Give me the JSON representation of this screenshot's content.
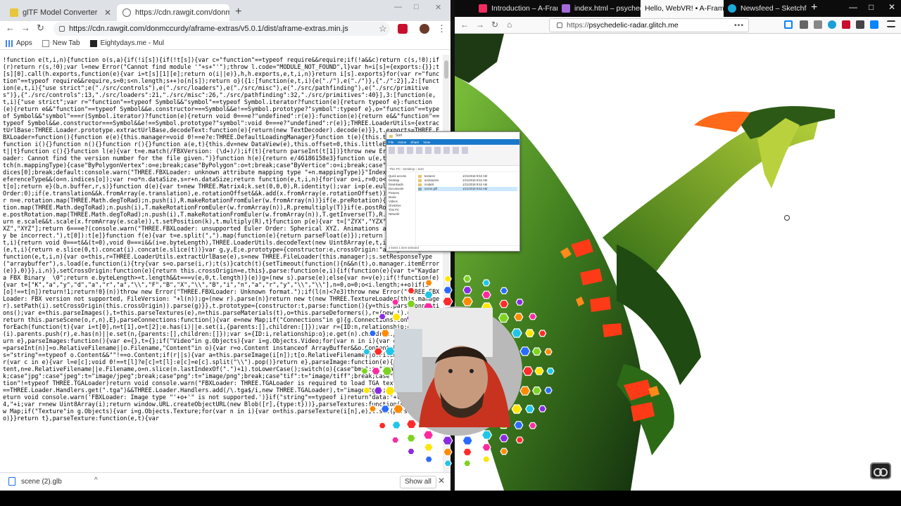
{
  "chrome": {
    "tabs": [
      {
        "title": "glTF Model Converter",
        "close": "✕"
      },
      {
        "title": "https://cdn.rawgit.com/donmccurdy",
        "close": "✕"
      }
    ],
    "new_tab": "+",
    "window_controls": [
      "—",
      "□",
      "✕"
    ],
    "nav": {
      "back": "←",
      "forward": "→",
      "reload": "↻"
    },
    "url": "https://cdn.rawgit.com/donmccurdy/aframe-extras/v5.0.1/dist/aframe-extras.min.js",
    "menu": "⋮",
    "bookmarks": [
      {
        "label": "Apps",
        "icon": "apps-grid-icon"
      },
      {
        "label": "New Tab",
        "icon": "page-icon"
      },
      {
        "label": "Eightydays.me - Mul",
        "icon": "eightydays-icon"
      }
    ],
    "code_text": "!function e(t,i,n){function o(s,a){if(!i[s]){if(!t[s]){var c=\"function\"==typeof require&&require;if(!a&&c)return c(s,!0);if(r)return r(s,!0);var l=new Error(\"Cannot find module '\"+s+\"'\");throw l.code=\"MODULE_NOT_FOUND\",l}var h=i[s]={exports:{}};t[s][0].call(h.exports,function(e){var i=t[s][1][e];return o(i||e)},h,h.exports,e,t,i,n)}return i[s].exports}for(var r=\"function\"==typeof require&&require,s=0;s<n.length;s++)o(n[s]);return o}({1:[function(e,t,i){e(\"./\"),e(\"./\")},{\"./\":2}],2:[function(e,t,i){\"use strict\";e(\"./src/controls\"),e(\"./src/loaders\"),e(\"./src/misc\"),e(\"./src/pathfinding\"),e(\"./src/primitives\")},{\"./src/controls\":13,\"./src/loaders\":21,\"./src/misc\":26,\"./src/pathfinding\":32,\"./src/primitives\":40}],3:[function(e,t,i){\"use strict\";var r=\"function\"==typeof Symbol&&\"symbol\"==typeof Symbol.iterator?function(e){return typeof e}:function(e){return e&&\"function\"==typeof Symbol&&e.constructor===Symbol&&e!==Symbol.prototype?\"symbol\":typeof e},o=\"function\"==typeof Symbol&&\"symbol\"===r(Symbol.iterator)?function(e){return void 0===e?\"undefined\":r(e)}:function(e){return e&&\"function\"==typeof Symbol&&e.constructor===Symbol&&e!==Symbol.prototype?\"symbol\":void 0===e?\"undefined\":r(e)};THREE.LoaderUtils={extractUrlBase:THREE.Loader.prototype.extractUrlBase,decodeText:function(e){return(new TextDecoder).decode(e)}},t.exports=THREE.FBXLoader=function(){function e(e){this.manager=void 0!==e?e:THREE.DefaultLoadingManager}function t(e){this.textureLoader=e}function i(){}function n(){}function r(){}function a(e,t){this.dv=new DataView(e),this.offset=0,this.littleEndian=void 0===t||t}function c(){}function l(e){var t=e.match(/FBXVersion: (\\d+)/);if(t){return parseInt(t[1])}throw new Error(\"THREE.FBXLoader: Cannot find the version number for the file given.\")}function h(e){return e/46186158e3}function u(e,t,i,n){var o;switch(n.mappingType){case\"ByPolygonVertex\":o=e;break;case\"ByPolygon\":o=t;break;case\"ByVertice\":o=i;break;case\"AllSame\":o=n.indices[0];break;default:console.warn(\"THREE.FBXLoader: unknown attribute mapping type \"+n.mappingType)}\"IndexToDirect\"===n.referenceType&&(o=n.indices[o]);var r=o*n.dataSize,s=r+n.dataSize;return function(e,t,i,n){for(var o=i,r=0;o<n;o++,r++)e[r]=t[o];return e}(b,n.buffer,r,s)}function d(e){var t=new THREE.Matrix4;k.set(0,0,0),R.identity();var i=p(e.eulerOrder?e.eulerOrder:0);if(e.translation&&k.fromArray(e.translation),e.rotationOffset&&k.add(x.fromArray(e.rotationOffset)),e.rotation){var n=e.rotation.map(THREE.Math.degToRad);n.push(i),R.makeRotationFromEuler(w.fromArray(n))}if(e.preRotation){var n=e.preRotation.map(THREE.Math.degToRad);n.push(i),T.makeRotationFromEuler(w.fromArray(n)),R.premultiply(T)}if(e.postRotation){var n=e.postRotation.map(THREE.Math.degToRad);n.push(i),T.makeRotationFromEuler(w.fromArray(n)),T.getInverse(T),R.multiply(T)}return e.scale&&t.scale(x.fromArray(e.scale)),t.setPosition(k),t.multiply(R),t}function p(e){var t=[\"ZYX\",\"YZX\",\"XZY\",\"ZXY\",\"YXZ\",\"XYZ\"];return 6===e?(console.warn(\"THREE.FBXLoader: unsupported Euler Order: Spherical XYZ. Animations and rotations may be incorrect.\"),t[0]):t[e]}function f(e){var t=e.split(\",\").map(function(e){return parseFloat(e)});return t}function v(e,t,i){return void 0===t&&(t=0),void 0===i&&(i=e.byteLength),THREE.LoaderUtils.decodeText(new Uint8Array(e,t,i))}function m(e,t,i){return e.slice(0,t).concat(i).concat(e.slice(t))}var g,y,E;e.prototype={constructor:e,crossOrigin:\"anonymous\",load:function(e,t,i,n){var o=this,r=THREE.LoaderUtils.extractUrlBase(e),s=new THREE.FileLoader(this.manager);s.setResponseType(\"arraybuffer\"),s.load(e,function(i){try{var s=o.parse(i,r);t(s)}catch(t){setTimeout(function(){n&&n(t),o.manager.itemError(e)},0)}},i,n)},setCrossOrigin:function(e){return this.crossOrigin=e,this},parse:function(e,i){if(function(e){var t=\"Kaydara FBX Binary  \\0\";return e.byteLength>=t.length&&t===v(e,0,t.length)}(e))g=(new s).parse(e);else{var n=v(e);if(!function(e){var t=[\"K\",\"a\",\"y\",\"d\",\"a\",\"r\",\"a\",\"\\\\\",\"F\",\"B\",\"X\",\"\\\\\",\"B\",\"i\",\"n\",\"a\",\"r\",\"y\",\"\\\\\",\"\\\\\"],n=0,o=0;o<i.length;++o)if(i[o]!==t[n])return!1;return!0}(n))throw new Error(\"THREE.FBXLoader: Unknown format.\");if(l(n)<7e3)throw new Error(\"THREE.FBXLoader: FBX version not supported, FileVersion: \"+l(n));g=(new r).parse(n)}return new t(new THREE.TextureLoader(this.manager).setPath(i).setCrossOrigin(this.crossOrigin)).parse(g)}},t.prototype={constructor:t,parse:function(){y=this.parseConnections();var e=this.parseImages(),t=this.parseTextures(e),n=this.parseMaterials(t),o=this.parseDeformers(),r=(new i).parse(o);return this.parseScene(o,r,n),E},parseConnections:function(){var e=new Map;if(\"Connections\"in g){g.Connections.connections.forEach(function(t){var i=t[0],n=t[1],o=t[2];e.has(i)||e.set(i,{parents:[],children:[]});var r={ID:n,relationship:o};e.get(i).parents.push(r),e.has(n)||e.set(n,{parents:[],children:[]});var s={ID:i,relationship:o};e.get(n).children.push(s)})}return e},parseImages:function(){var e={},t={};if(\"Video\"in g.Objects){var i=g.Objects.Video;for(var n in i){var o=i[n];if(e[n=parseInt(n)]=o.RelativeFilename||o.Filename,\"Content\"in o){var r=o.Content instanceof ArrayBuffer&&o.Content.byteLength>0,s=\"string\"==typeof o.Content&&\"\"!==o.Content;if(r||s){var a=this.parseImage(i[n]);t[o.RelativeFilename||o.Filename]=a}}}}for(var c in e){var l=e[c];void 0!==t[l]?e[c]=t[l]:e[c]=e[c].split(\"\\\\\").pop()}return e},parseImage:function(e){var t,i=e.Content,n=e.RelativeFilename||e.Filename,o=n.slice(n.lastIndexOf(\".\")+1).toLowerCase();switch(o){case\"bmp\":t=\"image/bmp\";break;case\"jpg\":case\"jpeg\":t=\"image/jpeg\";break;case\"png\":t=\"image/png\";break;case\"tif\":t=\"image/tiff\";break;case\"tga\":if(\"function\"!=typeof THREE.TGALoader)return void console.warn(\"FBXLoader: THREE.TGALoader is required to load TGA textures\");null===THREE.Loader.Handlers.get(\".tga\")&&THREE.Loader.Handlers.add(/\\.tga$/i,new THREE.TGALoader),t=\"image/tga\";break;default:return void console.warn('FBXLoader: Image type \"'+o+'\" is not supported.')}if(\"string\"==typeof i)return\"data:\"+t+\";base64,\"+i;var r=new Uint8Array(i);return window.URL.createObjectURL(new Blob([r],{type:t}))},parseTextures:function(e){var t=new Map;if(\"Texture\"in g.Objects){var i=g.Objects.Texture;for(var n in i){var o=this.parseTexture(i[n],e);t.set(parseInt(n),o)}}return t},parseTexture:function(e,t){var",
    "download": {
      "filename": "scene (2).glb",
      "caret": "^",
      "show_all": "Show all",
      "close": "✕"
    }
  },
  "firefox": {
    "tabs": [
      {
        "title": "Introduction – A-Fram",
        "close": "✕"
      },
      {
        "title": "index.html – psychedel",
        "close": "✕"
      },
      {
        "title": "Hello, WebVR! • A-Frame",
        "close": "✕"
      },
      {
        "title": "Newsfeed – Sketchfab",
        "close": "✕"
      }
    ],
    "new_tab": "+",
    "window_controls": [
      "—",
      "□",
      "✕"
    ],
    "nav": {
      "back": "←",
      "forward": "→",
      "reload": "↻",
      "home": "⌂"
    },
    "url_scheme": "https://",
    "url_host": "psychedelic-radar.glitch.me",
    "url_more": "•••",
    "colors": {
      "scene_bg": "#ffffff",
      "dragon_green": "#3d7a1e",
      "dragon_dark": "#14310e",
      "scale_red": "#ff3b17",
      "scale_orange": "#ff8a1c"
    }
  },
  "explorer": {
    "title": "Sort",
    "ribbon_tabs": [
      "File",
      "Home",
      "Share",
      "View"
    ],
    "address": "This PC › Desktop › Sort",
    "nav_items": [
      "Quick access",
      "Desktop",
      "Downloads",
      "Documents",
      "Pictures",
      "Music",
      "Videos",
      "OneDrive",
      "This PC",
      "Network"
    ],
    "files": [
      {
        "name": "textures",
        "date": "1/21/2018 9:52 AM"
      },
      {
        "name": "animations",
        "date": "1/21/2018 9:52 AM"
      },
      {
        "name": "models",
        "date": "1/21/2018 9:52 AM"
      },
      {
        "name": "scene.gltf",
        "date": "1/21/2018 9:52 AM"
      }
    ],
    "status": "4 items  1 item selected"
  }
}
